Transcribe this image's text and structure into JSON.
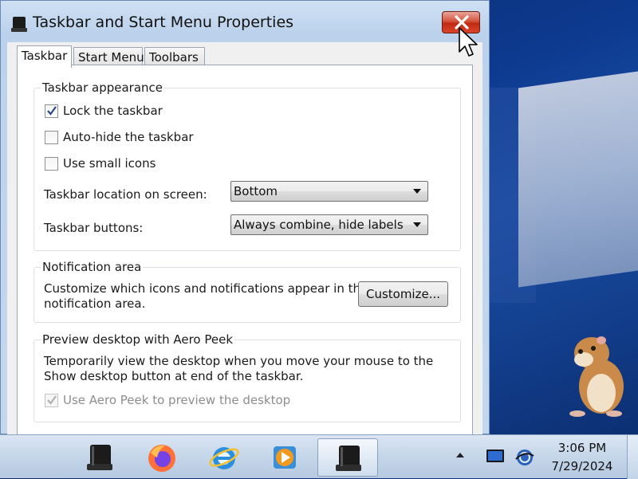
{
  "window": {
    "title": "Taskbar and Start Menu Properties"
  },
  "tabs": [
    {
      "label": "Taskbar",
      "active": true
    },
    {
      "label": "Start Menu",
      "active": false
    },
    {
      "label": "Toolbars",
      "active": false
    }
  ],
  "taskbar_appearance": {
    "title": "Taskbar appearance",
    "lock": {
      "label": "Lock the taskbar",
      "checked": true
    },
    "autohide": {
      "label": "Auto-hide the taskbar",
      "checked": false
    },
    "small_icons": {
      "label": "Use small icons",
      "checked": false
    },
    "location_label": "Taskbar location on screen:",
    "location_value": "Bottom",
    "buttons_label": "Taskbar buttons:",
    "buttons_value": "Always combine, hide labels"
  },
  "notification_area": {
    "title": "Notification area",
    "description_line1": "Customize which icons and notifications appear in the",
    "description_line2": "notification area.",
    "customize_button": "Customize..."
  },
  "aero_peek": {
    "title": "Preview desktop with Aero Peek",
    "description_line1": "Temporarily view the desktop when you move your mouse to the",
    "description_line2": "Show desktop button at end of the taskbar.",
    "checkbox": {
      "label": "Use Aero Peek to preview the desktop",
      "checked": true,
      "disabled": true
    }
  },
  "taskbar": {
    "apps": [
      {
        "name": "taskbar-properties",
        "icon": "taskbar-icon"
      },
      {
        "name": "firefox",
        "icon": "firefox-icon"
      },
      {
        "name": "internet-explorer",
        "icon": "internet-explorer-icon"
      },
      {
        "name": "media-player",
        "icon": "media-player-icon"
      },
      {
        "name": "taskbar-properties-active",
        "icon": "taskbar-icon",
        "active": true
      }
    ],
    "tray_icons": [
      "show-hidden-icons",
      "action-center-icon",
      "network-icon"
    ],
    "clock_time": "3:06 PM",
    "clock_date": "7/29/2024"
  },
  "colors": {
    "close_red": "#c02a13",
    "accent_blue": "#1a4fa8"
  }
}
